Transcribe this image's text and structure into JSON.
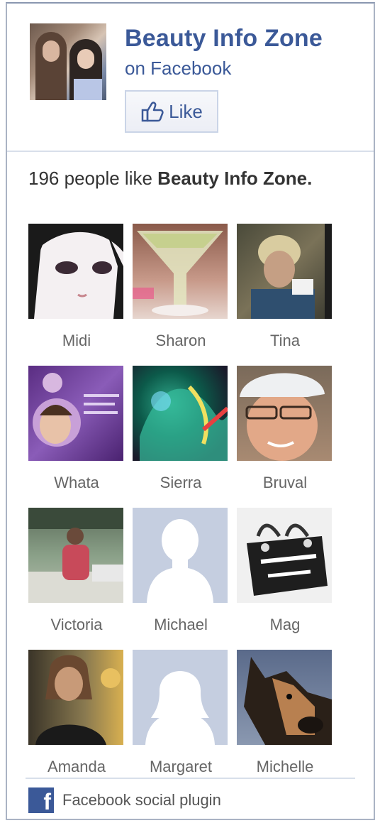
{
  "page": {
    "title": "Beauty Info Zone",
    "subtitle": "on Facebook",
    "like_label": "Like"
  },
  "likes": {
    "count": "196",
    "prefix": "people like",
    "page_name": "Beauty Info Zone."
  },
  "fans": [
    {
      "name": "Midi",
      "photo": "anime-girl"
    },
    {
      "name": "Sharon",
      "photo": "martini-glass"
    },
    {
      "name": "Tina",
      "photo": "blonde-woman"
    },
    {
      "name": "Whata",
      "photo": "purple-collage"
    },
    {
      "name": "Sierra",
      "photo": "colorful-abstract"
    },
    {
      "name": "Bruval",
      "photo": "woman-white-cap"
    },
    {
      "name": "Victoria",
      "photo": "woman-outdoors"
    },
    {
      "name": "Michael",
      "photo": "default-silhouette-male"
    },
    {
      "name": "Mag",
      "photo": "shopping-bag"
    },
    {
      "name": "Amanda",
      "photo": "woman-portrait"
    },
    {
      "name": "Margaret",
      "photo": "default-silhouette-female"
    },
    {
      "name": "Michelle",
      "photo": "german-shepherd"
    }
  ],
  "footer": {
    "text": "Facebook social plugin",
    "icon": "facebook-f-icon"
  },
  "colors": {
    "brand": "#3b5998",
    "border": "#aab3c4",
    "button_border": "#cad4e7",
    "name_text": "#666666"
  }
}
